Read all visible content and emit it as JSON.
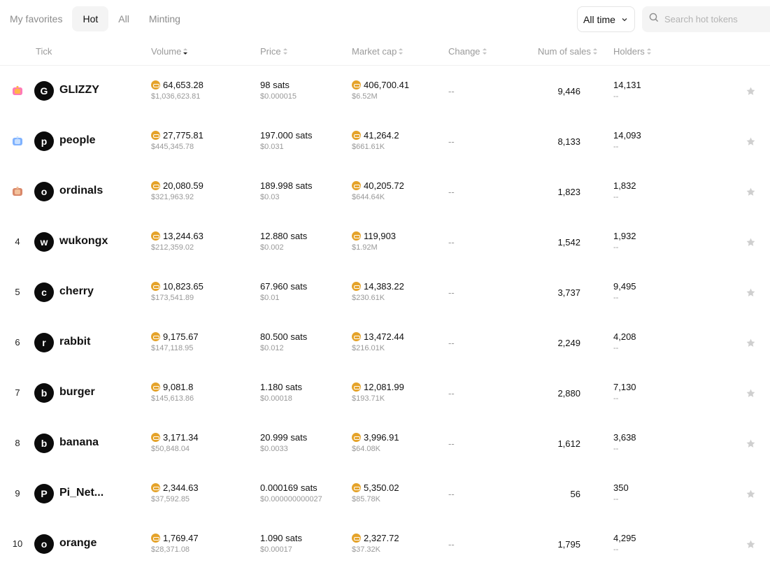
{
  "tabs": {
    "favorites": "My favorites",
    "hot": "Hot",
    "all": "All",
    "minting": "Minting"
  },
  "time_filter": "All time",
  "search": {
    "placeholder": "Search hot tokens"
  },
  "columns": {
    "tick": "Tick",
    "volume": "Volume",
    "price": "Price",
    "market_cap": "Market cap",
    "change": "Change",
    "num_sales": "Num of sales",
    "holders": "Holders"
  },
  "colors": {
    "coin": "#e5a32a",
    "accent_dark": "#0b0b0b",
    "muted": "#999999"
  },
  "rows": [
    {
      "rank": "",
      "medal": "gold-medal-icon",
      "avatar": "G",
      "name": "GLIZZY",
      "volume": "64,653.28",
      "volume_usd": "$1,036,623.81",
      "price": "98 sats",
      "price_usd": "$0.000015",
      "mcap": "406,700.41",
      "mcap_usd": "$6.52M",
      "change": "--",
      "sales": "9,446",
      "holders": "14,131",
      "holders_change": "--"
    },
    {
      "rank": "",
      "medal": "silver-medal-icon",
      "avatar": "p",
      "name": "people",
      "volume": "27,775.81",
      "volume_usd": "$445,345.78",
      "price": "197.000 sats",
      "price_usd": "$0.031",
      "mcap": "41,264.2",
      "mcap_usd": "$661.61K",
      "change": "--",
      "sales": "8,133",
      "holders": "14,093",
      "holders_change": "--"
    },
    {
      "rank": "",
      "medal": "bronze-medal-icon",
      "avatar": "o",
      "name": "ordinals",
      "volume": "20,080.59",
      "volume_usd": "$321,963.92",
      "price": "189.998 sats",
      "price_usd": "$0.03",
      "mcap": "40,205.72",
      "mcap_usd": "$644.64K",
      "change": "--",
      "sales": "1,823",
      "holders": "1,832",
      "holders_change": "--"
    },
    {
      "rank": "4",
      "medal": "",
      "avatar": "w",
      "name": "wukongx",
      "volume": "13,244.63",
      "volume_usd": "$212,359.02",
      "price": "12.880 sats",
      "price_usd": "$0.002",
      "mcap": "119,903",
      "mcap_usd": "$1.92M",
      "change": "--",
      "sales": "1,542",
      "holders": "1,932",
      "holders_change": "--"
    },
    {
      "rank": "5",
      "medal": "",
      "avatar": "c",
      "name": "cherry",
      "volume": "10,823.65",
      "volume_usd": "$173,541.89",
      "price": "67.960 sats",
      "price_usd": "$0.01",
      "mcap": "14,383.22",
      "mcap_usd": "$230.61K",
      "change": "--",
      "sales": "3,737",
      "holders": "9,495",
      "holders_change": "--"
    },
    {
      "rank": "6",
      "medal": "",
      "avatar": "r",
      "name": "rabbit",
      "volume": "9,175.67",
      "volume_usd": "$147,118.95",
      "price": "80.500 sats",
      "price_usd": "$0.012",
      "mcap": "13,472.44",
      "mcap_usd": "$216.01K",
      "change": "--",
      "sales": "2,249",
      "holders": "4,208",
      "holders_change": "--"
    },
    {
      "rank": "7",
      "medal": "",
      "avatar": "b",
      "name": "burger",
      "volume": "9,081.8",
      "volume_usd": "$145,613.86",
      "price": "1.180 sats",
      "price_usd": "$0.00018",
      "mcap": "12,081.99",
      "mcap_usd": "$193.71K",
      "change": "--",
      "sales": "2,880",
      "holders": "7,130",
      "holders_change": "--"
    },
    {
      "rank": "8",
      "medal": "",
      "avatar": "b",
      "name": "banana",
      "volume": "3,171.34",
      "volume_usd": "$50,848.04",
      "price": "20.999 sats",
      "price_usd": "$0.0033",
      "mcap": "3,996.91",
      "mcap_usd": "$64.08K",
      "change": "--",
      "sales": "1,612",
      "holders": "3,638",
      "holders_change": "--"
    },
    {
      "rank": "9",
      "medal": "",
      "avatar": "P",
      "name": "Pi_Net...",
      "volume": "2,344.63",
      "volume_usd": "$37,592.85",
      "price": "0.000169 sats",
      "price_usd": "$0.000000000027",
      "mcap": "5,350.02",
      "mcap_usd": "$85.78K",
      "change": "--",
      "sales": "56",
      "holders": "350",
      "holders_change": "--"
    },
    {
      "rank": "10",
      "medal": "",
      "avatar": "o",
      "name": "orange",
      "volume": "1,769.47",
      "volume_usd": "$28,371.08",
      "price": "1.090 sats",
      "price_usd": "$0.00017",
      "mcap": "2,327.72",
      "mcap_usd": "$37.32K",
      "change": "--",
      "sales": "1,795",
      "holders": "4,295",
      "holders_change": "--"
    }
  ]
}
